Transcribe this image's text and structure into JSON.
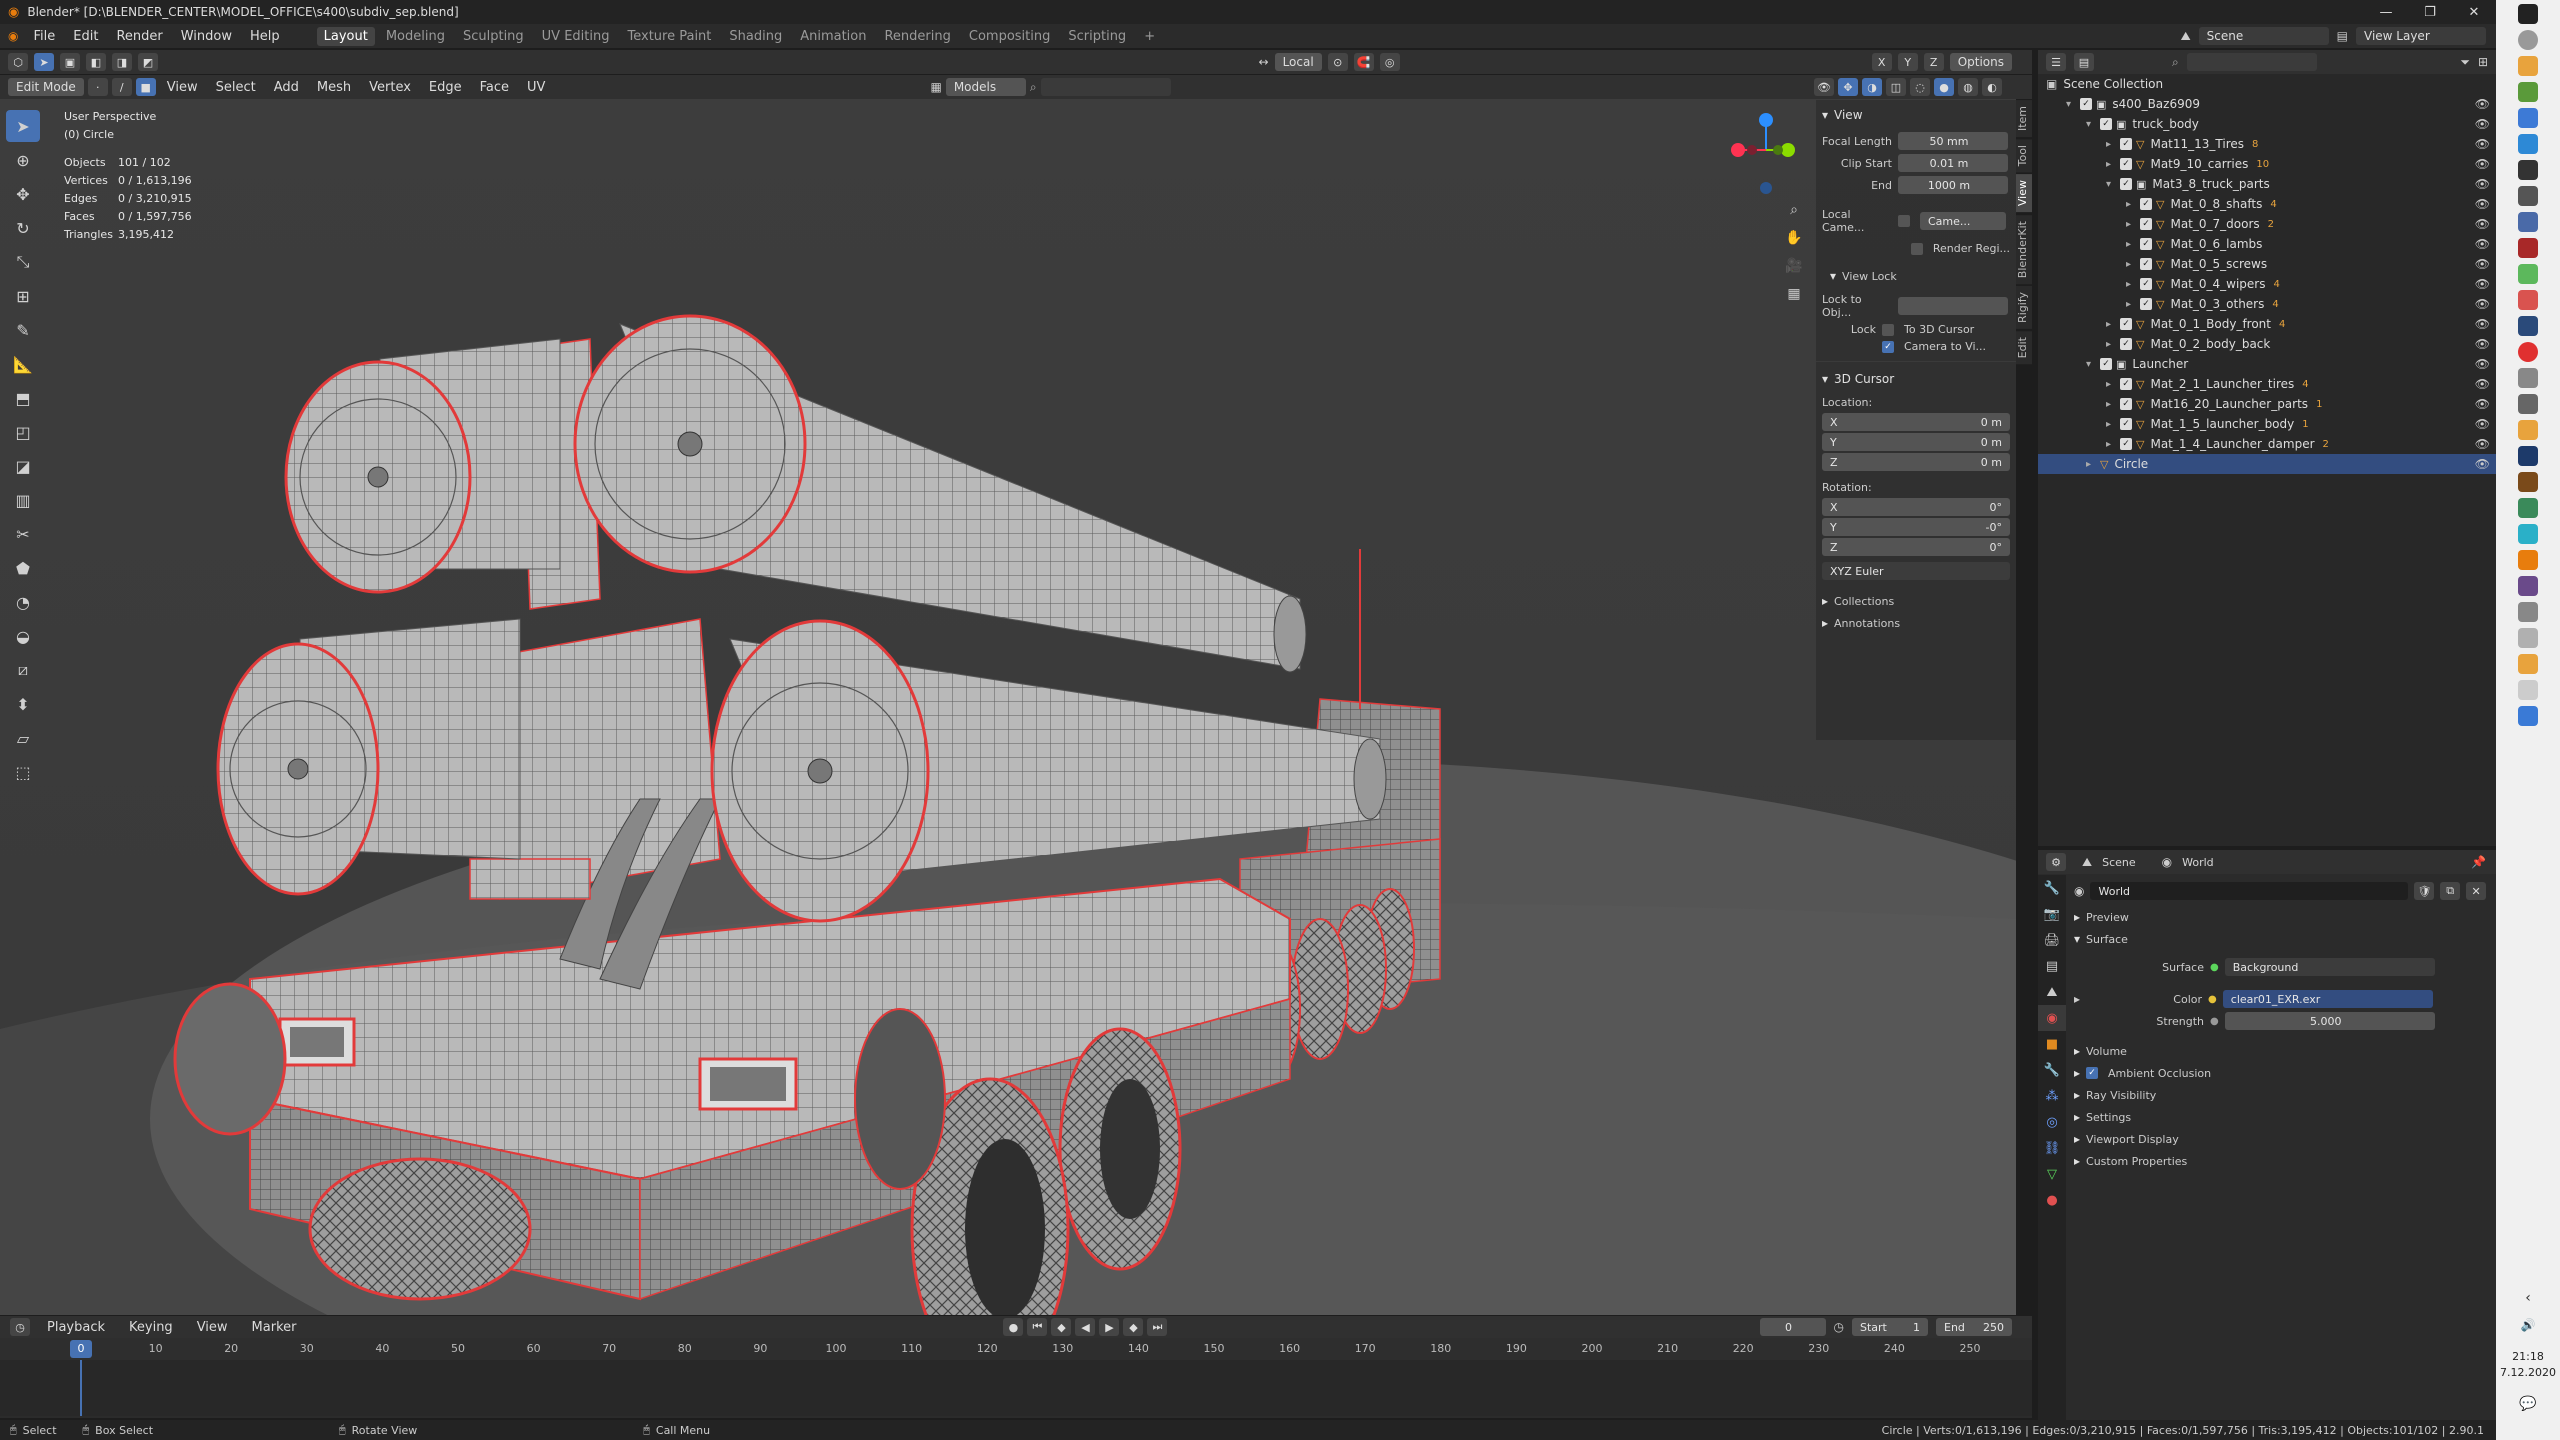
{
  "titlebar": {
    "title": "Blender* [D:\\BLENDER_CENTER\\MODEL_OFFICE\\s400\\subdiv_sep.blend]",
    "min": "—",
    "max": "❐",
    "close": "✕"
  },
  "menu": {
    "items": [
      "File",
      "Edit",
      "Render",
      "Window",
      "Help"
    ],
    "workspaces": [
      "Layout",
      "Modeling",
      "Sculpting",
      "UV Editing",
      "Texture Paint",
      "Shading",
      "Animation",
      "Rendering",
      "Compositing",
      "Scripting"
    ],
    "add_workspace": "+"
  },
  "topright": {
    "scene_label": "Scene",
    "view_layer_label": "View Layer"
  },
  "header1": {
    "transform_orientation": "Local",
    "axes": [
      "X",
      "Y",
      "Z"
    ],
    "options": "Options"
  },
  "header2": {
    "mode": "Edit Mode",
    "menus": [
      "View",
      "Select",
      "Add",
      "Mesh",
      "Vertex",
      "Edge",
      "Face",
      "UV"
    ],
    "collection": "Models"
  },
  "viewport": {
    "view_name": "User Perspective",
    "object_name": "(0) Circle",
    "stats": [
      {
        "label": "Objects",
        "value": "101 / 102"
      },
      {
        "label": "Vertices",
        "value": "0 / 1,613,196"
      },
      {
        "label": "Edges",
        "value": "0 / 3,210,915"
      },
      {
        "label": "Faces",
        "value": "0 / 1,597,756"
      },
      {
        "label": "Triangles",
        "value": "3,195,412"
      }
    ]
  },
  "npanel": {
    "tabs": [
      "Item",
      "Tool",
      "View",
      "BlenderKit",
      "Rigify",
      "Edit"
    ],
    "view_header": "View",
    "focal_length_label": "Focal Length",
    "focal_length": "50 mm",
    "clip_start_label": "Clip Start",
    "clip_start": "0.01 m",
    "clip_end_label": "End",
    "clip_end": "1000 m",
    "local_camera_label": "Local Came...",
    "local_camera_value": "Came...",
    "render_region_label": "Render Regi...",
    "view_lock_header": "View Lock",
    "lock_to_obj_label": "Lock to Obj...",
    "lock_label": "Lock",
    "to_3d_cursor_label": "To 3D Cursor",
    "camera_to_view_label": "Camera to Vi...",
    "cursor_header": "3D Cursor",
    "location_label": "Location:",
    "loc": [
      {
        "axis": "X",
        "value": "0 m"
      },
      {
        "axis": "Y",
        "value": "0 m"
      },
      {
        "axis": "Z",
        "value": "0 m"
      }
    ],
    "rotation_label": "Rotation:",
    "rot": [
      {
        "axis": "X",
        "value": "0°"
      },
      {
        "axis": "Y",
        "value": "-0°"
      },
      {
        "axis": "Z",
        "value": "0°"
      }
    ],
    "rotation_mode": "XYZ Euler",
    "collections_label": "Collections",
    "annotations_label": "Annotations"
  },
  "outliner": {
    "root": "Scene Collection",
    "rows": [
      {
        "label": "s400_Baz6909",
        "level": 1,
        "kind": "collection"
      },
      {
        "label": "truck_body",
        "level": 2,
        "kind": "collection"
      },
      {
        "label": "Mat11_13_Tires",
        "level": 3,
        "kind": "object",
        "badge": "8"
      },
      {
        "label": "Mat9_10_carries",
        "level": 3,
        "kind": "object",
        "badge": "10"
      },
      {
        "label": "Mat3_8_truck_parts",
        "level": 3,
        "kind": "collection"
      },
      {
        "label": "Mat_0_8_shafts",
        "level": 4,
        "kind": "object",
        "badge": "4"
      },
      {
        "label": "Mat_0_7_doors",
        "level": 4,
        "kind": "object",
        "badge": "2"
      },
      {
        "label": "Mat_0_6_lambs",
        "level": 4,
        "kind": "object",
        "badge": ""
      },
      {
        "label": "Mat_0_5_screws",
        "level": 4,
        "kind": "object",
        "badge": ""
      },
      {
        "label": "Mat_0_4_wipers",
        "level": 4,
        "kind": "object",
        "badge": "4"
      },
      {
        "label": "Mat_0_3_others",
        "level": 4,
        "kind": "object",
        "badge": "4"
      },
      {
        "label": "Mat_0_1_Body_front",
        "level": 3,
        "kind": "object",
        "badge": "4"
      },
      {
        "label": "Mat_0_2_body_back",
        "level": 3,
        "kind": "object",
        "badge": ""
      },
      {
        "label": "Launcher",
        "level": 2,
        "kind": "collection"
      },
      {
        "label": "Mat_2_1_Launcher_tires",
        "level": 3,
        "kind": "object",
        "badge": "4"
      },
      {
        "label": "Mat16_20_Launcher_parts",
        "level": 3,
        "kind": "object",
        "badge": "1"
      },
      {
        "label": "Mat_1_5_launcher_body",
        "level": 3,
        "kind": "object",
        "badge": "1"
      },
      {
        "label": "Mat_1_4_Launcher_damper",
        "level": 3,
        "kind": "object",
        "badge": "2"
      },
      {
        "label": "Circle",
        "level": 2,
        "kind": "selected"
      }
    ]
  },
  "properties": {
    "breadcrumb_scene": "Scene",
    "breadcrumb_world": "World",
    "world_name": "World",
    "sections": [
      "Preview",
      "Surface"
    ],
    "surface_label": "Surface",
    "surface_value": "Background",
    "color_label": "Color",
    "color_value": "clear01_EXR.exr",
    "strength_label": "Strength",
    "strength_value": "5.000",
    "more_sections": [
      "Volume",
      "Ambient Occlusion",
      "Ray Visibility",
      "Settings",
      "Viewport Display",
      "Custom Properties"
    ]
  },
  "timeline": {
    "menus": [
      "Playback",
      "Keying",
      "View",
      "Marker"
    ],
    "current_frame": "0",
    "start_label": "Start",
    "start": "1",
    "end_label": "End",
    "end": "250",
    "ticks": [
      "0",
      "10",
      "20",
      "30",
      "40",
      "50",
      "60",
      "70",
      "80",
      "90",
      "100",
      "110",
      "120",
      "130",
      "140",
      "150",
      "160",
      "170",
      "180",
      "190",
      "200",
      "210",
      "220",
      "230",
      "240",
      "250"
    ],
    "playhead": "0"
  },
  "statusbar": {
    "select": "Select",
    "box_select": "Box Select",
    "rotate_view": "Rotate View",
    "call_menu": "Call Menu",
    "info": "Circle | Verts:0/1,613,196 | Edges:0/3,210,915 | Faces:0/1,597,756 | Tris:3,195,412 | Objects:101/102 | 2.90.1"
  },
  "taskbar": {
    "time": "21:18",
    "date": "7.12.2020"
  },
  "colors": {
    "accent": "#4772b3",
    "selected_row": "#334d80",
    "wire": "#cfcfcf",
    "seam": "#e23a3a"
  }
}
